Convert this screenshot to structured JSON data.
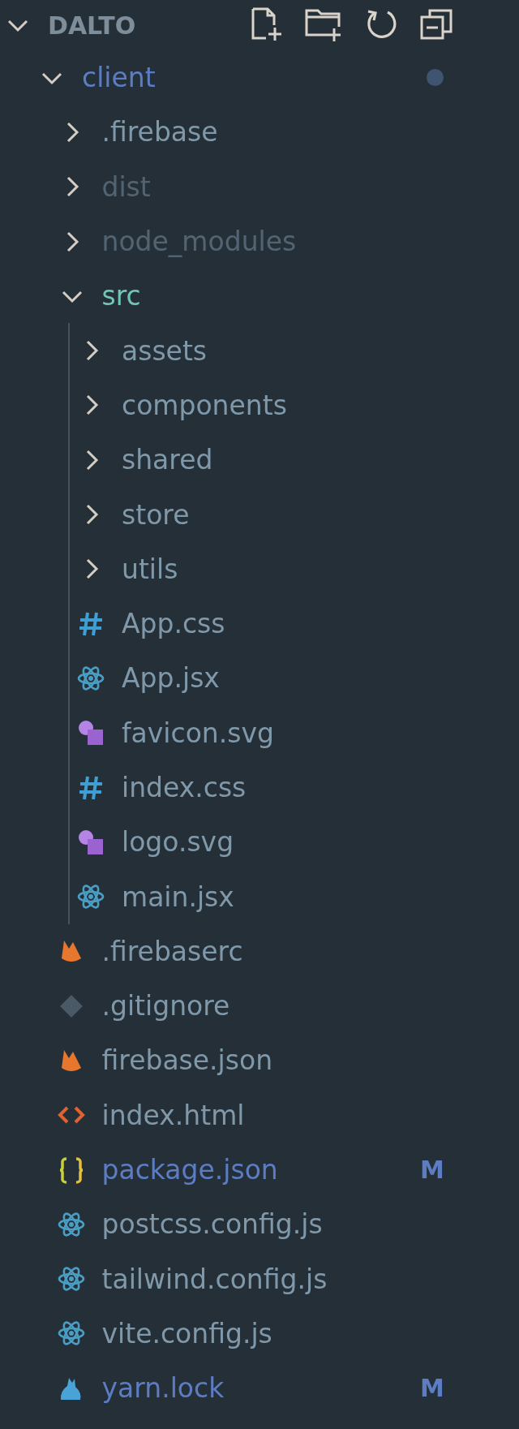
{
  "section": {
    "title": "DALTO",
    "expanded": true
  },
  "tree": [
    {
      "name": "client",
      "kind": "folder",
      "expanded": true,
      "modified": true,
      "ignored": false,
      "untracked": false,
      "children": [
        {
          "name": ".firebase",
          "kind": "folder",
          "expanded": false,
          "modified": false,
          "ignored": false,
          "untracked": false
        },
        {
          "name": "dist",
          "kind": "folder",
          "expanded": false,
          "modified": false,
          "ignored": true,
          "untracked": false
        },
        {
          "name": "node_modules",
          "kind": "folder",
          "expanded": false,
          "modified": false,
          "ignored": true,
          "untracked": false
        },
        {
          "name": "src",
          "kind": "folder",
          "expanded": true,
          "modified": false,
          "ignored": false,
          "untracked": true,
          "children": [
            {
              "name": "assets",
              "kind": "folder",
              "expanded": false,
              "modified": false,
              "ignored": false,
              "untracked": false
            },
            {
              "name": "components",
              "kind": "folder",
              "expanded": false,
              "modified": false,
              "ignored": false,
              "untracked": false
            },
            {
              "name": "shared",
              "kind": "folder",
              "expanded": false,
              "modified": false,
              "ignored": false,
              "untracked": false
            },
            {
              "name": "store",
              "kind": "folder",
              "expanded": false,
              "modified": false,
              "ignored": false,
              "untracked": false
            },
            {
              "name": "utils",
              "kind": "folder",
              "expanded": false,
              "modified": false,
              "ignored": false,
              "untracked": false
            },
            {
              "name": "App.css",
              "kind": "css",
              "modified": false,
              "ignored": false,
              "untracked": false
            },
            {
              "name": "App.jsx",
              "kind": "react",
              "modified": false,
              "ignored": false,
              "untracked": false
            },
            {
              "name": "favicon.svg",
              "kind": "svg",
              "modified": false,
              "ignored": false,
              "untracked": false
            },
            {
              "name": "index.css",
              "kind": "css",
              "modified": false,
              "ignored": false,
              "untracked": false
            },
            {
              "name": "logo.svg",
              "kind": "svg",
              "modified": false,
              "ignored": false,
              "untracked": false
            },
            {
              "name": "main.jsx",
              "kind": "react",
              "modified": false,
              "ignored": false,
              "untracked": false
            }
          ]
        },
        {
          "name": ".firebaserc",
          "kind": "firebase",
          "modified": false,
          "ignored": false,
          "untracked": false
        },
        {
          "name": ".gitignore",
          "kind": "git",
          "modified": false,
          "ignored": false,
          "untracked": false
        },
        {
          "name": "firebase.json",
          "kind": "firebase",
          "modified": false,
          "ignored": false,
          "untracked": false
        },
        {
          "name": "index.html",
          "kind": "html",
          "modified": false,
          "ignored": false,
          "untracked": false
        },
        {
          "name": "package.json",
          "kind": "json",
          "modified": true,
          "ignored": false,
          "untracked": false,
          "badge": "M"
        },
        {
          "name": "postcss.config.js",
          "kind": "react",
          "modified": false,
          "ignored": false,
          "untracked": false
        },
        {
          "name": "tailwind.config.js",
          "kind": "react",
          "modified": false,
          "ignored": false,
          "untracked": false
        },
        {
          "name": "vite.config.js",
          "kind": "react",
          "modified": false,
          "ignored": false,
          "untracked": false
        },
        {
          "name": "yarn.lock",
          "kind": "yarn",
          "modified": true,
          "ignored": false,
          "untracked": false,
          "badge": "M"
        }
      ]
    }
  ]
}
